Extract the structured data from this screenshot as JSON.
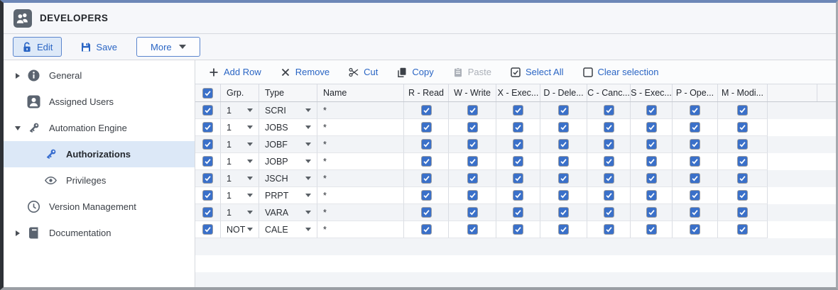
{
  "window": {
    "title": "DEVELOPERS"
  },
  "toolbar": {
    "edit_label": "Edit",
    "save_label": "Save",
    "more_label": "More"
  },
  "sidebar": {
    "items": [
      {
        "label": "General",
        "icon": "info-icon",
        "expander": "collapsed",
        "nested": false,
        "selected": false
      },
      {
        "label": "Assigned Users",
        "icon": "user-icon",
        "expander": "none",
        "nested": false,
        "selected": false
      },
      {
        "label": "Automation Engine",
        "icon": "key-icon",
        "expander": "expanded",
        "nested": false,
        "selected": false
      },
      {
        "label": "Authorizations",
        "icon": "key-icon",
        "expander": "none",
        "nested": true,
        "selected": true
      },
      {
        "label": "Privileges",
        "icon": "eye-icon",
        "expander": "none",
        "nested": true,
        "selected": false
      },
      {
        "label": "Version Management",
        "icon": "clock-icon",
        "expander": "none",
        "nested": false,
        "selected": false
      },
      {
        "label": "Documentation",
        "icon": "book-icon",
        "expander": "collapsed",
        "nested": false,
        "selected": false
      }
    ]
  },
  "table_toolbar": {
    "actions": [
      {
        "label": "Add Row",
        "icon": "plus-icon",
        "enabled": true
      },
      {
        "label": "Remove",
        "icon": "remove-icon",
        "enabled": true
      },
      {
        "label": "Cut",
        "icon": "scissors-icon",
        "enabled": true
      },
      {
        "label": "Copy",
        "icon": "copy-icon",
        "enabled": true
      },
      {
        "label": "Paste",
        "icon": "paste-icon",
        "enabled": false
      },
      {
        "label": "Select All",
        "icon": "select-all-icon",
        "enabled": true
      },
      {
        "label": "Clear selection",
        "icon": "clear-selection-icon",
        "enabled": true
      }
    ]
  },
  "grid": {
    "header_checkbox_checked": true,
    "columns": [
      "Grp.",
      "Type",
      "Name",
      "R - Read",
      "W - Write",
      "X - Exec...",
      "D - Dele...",
      "C - Canc...",
      "S - Exec...",
      "P - Ope...",
      "M - Modi..."
    ],
    "rows": [
      {
        "selected": true,
        "grp": "1",
        "type": "SCRI",
        "name": "*",
        "perms": [
          true,
          true,
          true,
          true,
          true,
          true,
          true,
          true
        ]
      },
      {
        "selected": true,
        "grp": "1",
        "type": "JOBS",
        "name": "*",
        "perms": [
          true,
          true,
          true,
          true,
          true,
          true,
          true,
          true
        ]
      },
      {
        "selected": true,
        "grp": "1",
        "type": "JOBF",
        "name": "*",
        "perms": [
          true,
          true,
          true,
          true,
          true,
          true,
          true,
          true
        ]
      },
      {
        "selected": true,
        "grp": "1",
        "type": "JOBP",
        "name": "*",
        "perms": [
          true,
          true,
          true,
          true,
          true,
          true,
          true,
          true
        ]
      },
      {
        "selected": true,
        "grp": "1",
        "type": "JSCH",
        "name": "*",
        "perms": [
          true,
          true,
          true,
          true,
          true,
          true,
          true,
          true
        ]
      },
      {
        "selected": true,
        "grp": "1",
        "type": "PRPT",
        "name": "*",
        "perms": [
          true,
          true,
          true,
          true,
          true,
          true,
          true,
          true
        ]
      },
      {
        "selected": true,
        "grp": "1",
        "type": "VARA",
        "name": "*",
        "perms": [
          true,
          true,
          true,
          true,
          true,
          true,
          true,
          true
        ]
      },
      {
        "selected": true,
        "grp": "NOT",
        "type": "CALE",
        "name": "*",
        "perms": [
          true,
          true,
          true,
          true,
          true,
          true,
          true,
          true
        ]
      }
    ]
  },
  "colors": {
    "accent_blue": "#2a65c4",
    "checkbox_blue": "#3a70c9",
    "selected_item_bg": "#dce8f7",
    "alt_row_bg": "#f2f4f7",
    "frame_top": "#6d87b7"
  }
}
